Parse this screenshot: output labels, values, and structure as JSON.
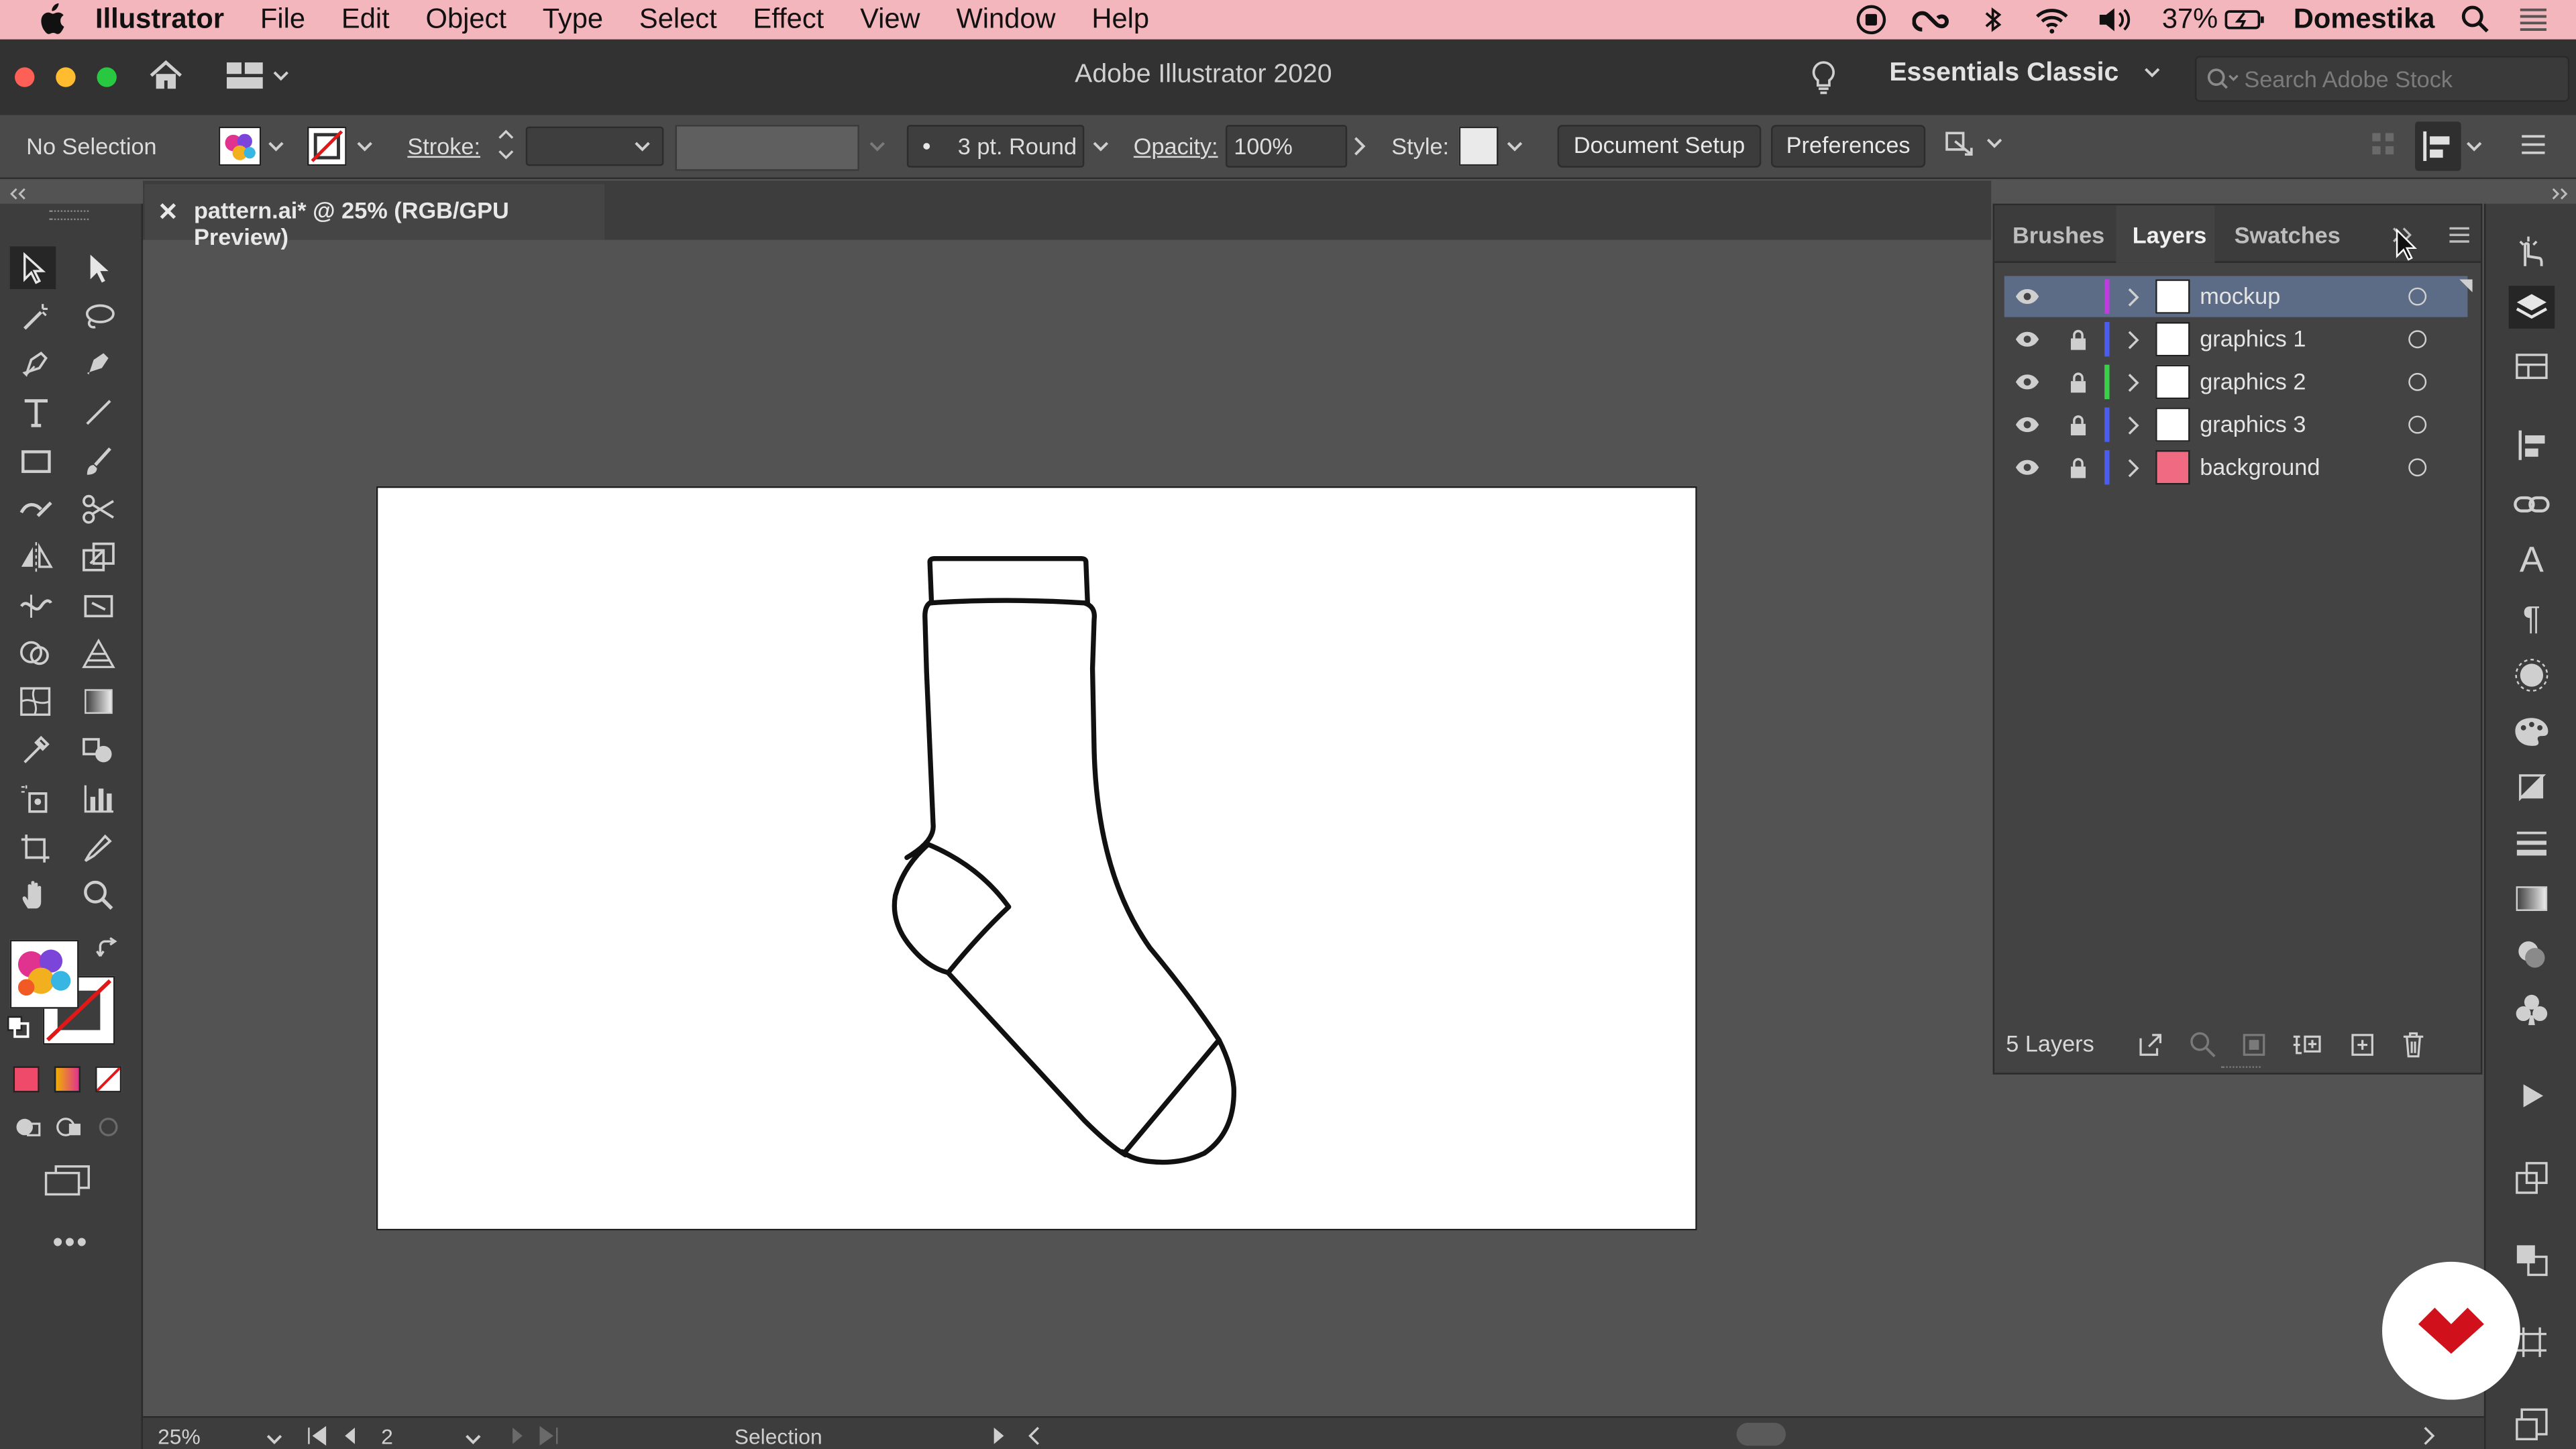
{
  "menubar": {
    "app_name": "Illustrator",
    "items": [
      "File",
      "Edit",
      "Object",
      "Type",
      "Select",
      "Effect",
      "View",
      "Window",
      "Help"
    ],
    "battery": "37%",
    "user": "Domestika"
  },
  "titlebar": {
    "title": "Adobe Illustrator 2020",
    "workspace": "Essentials Classic",
    "search_placeholder": "Search Adobe Stock"
  },
  "control_bar": {
    "selection_label": "No Selection",
    "stroke_label": "Stroke:",
    "stroke_value": "",
    "brush_value": "3 pt. Round",
    "opacity_label": "Opacity:",
    "opacity_value": "100%",
    "style_label": "Style:",
    "document_setup": "Document Setup",
    "preferences": "Preferences"
  },
  "document": {
    "tab_title": "pattern.ai* @ 25% (RGB/GPU Preview)"
  },
  "layers_panel": {
    "tabs": [
      "Brushes",
      "Layers",
      "Swatches"
    ],
    "active_tab": "Layers",
    "layers": [
      {
        "name": "mockup",
        "color": "#c03ce0",
        "locked": false,
        "selected": true
      },
      {
        "name": "graphics 1",
        "color": "#4b5cf0",
        "locked": true,
        "selected": false
      },
      {
        "name": "graphics 2",
        "color": "#3bd04a",
        "locked": true,
        "selected": false
      },
      {
        "name": "graphics 3",
        "color": "#4b5cf0",
        "locked": true,
        "selected": false
      },
      {
        "name": "background",
        "color": "#4b5cf0",
        "locked": true,
        "selected": false
      }
    ],
    "count_label": "5 Layers"
  },
  "status_bar": {
    "zoom": "25%",
    "artboard_number": "2",
    "tool_status": "Selection"
  },
  "colors": {
    "menubar_bg": "#f4b6bd",
    "selected_layer": "#5c6b86",
    "brand_red": "#d0111b"
  }
}
